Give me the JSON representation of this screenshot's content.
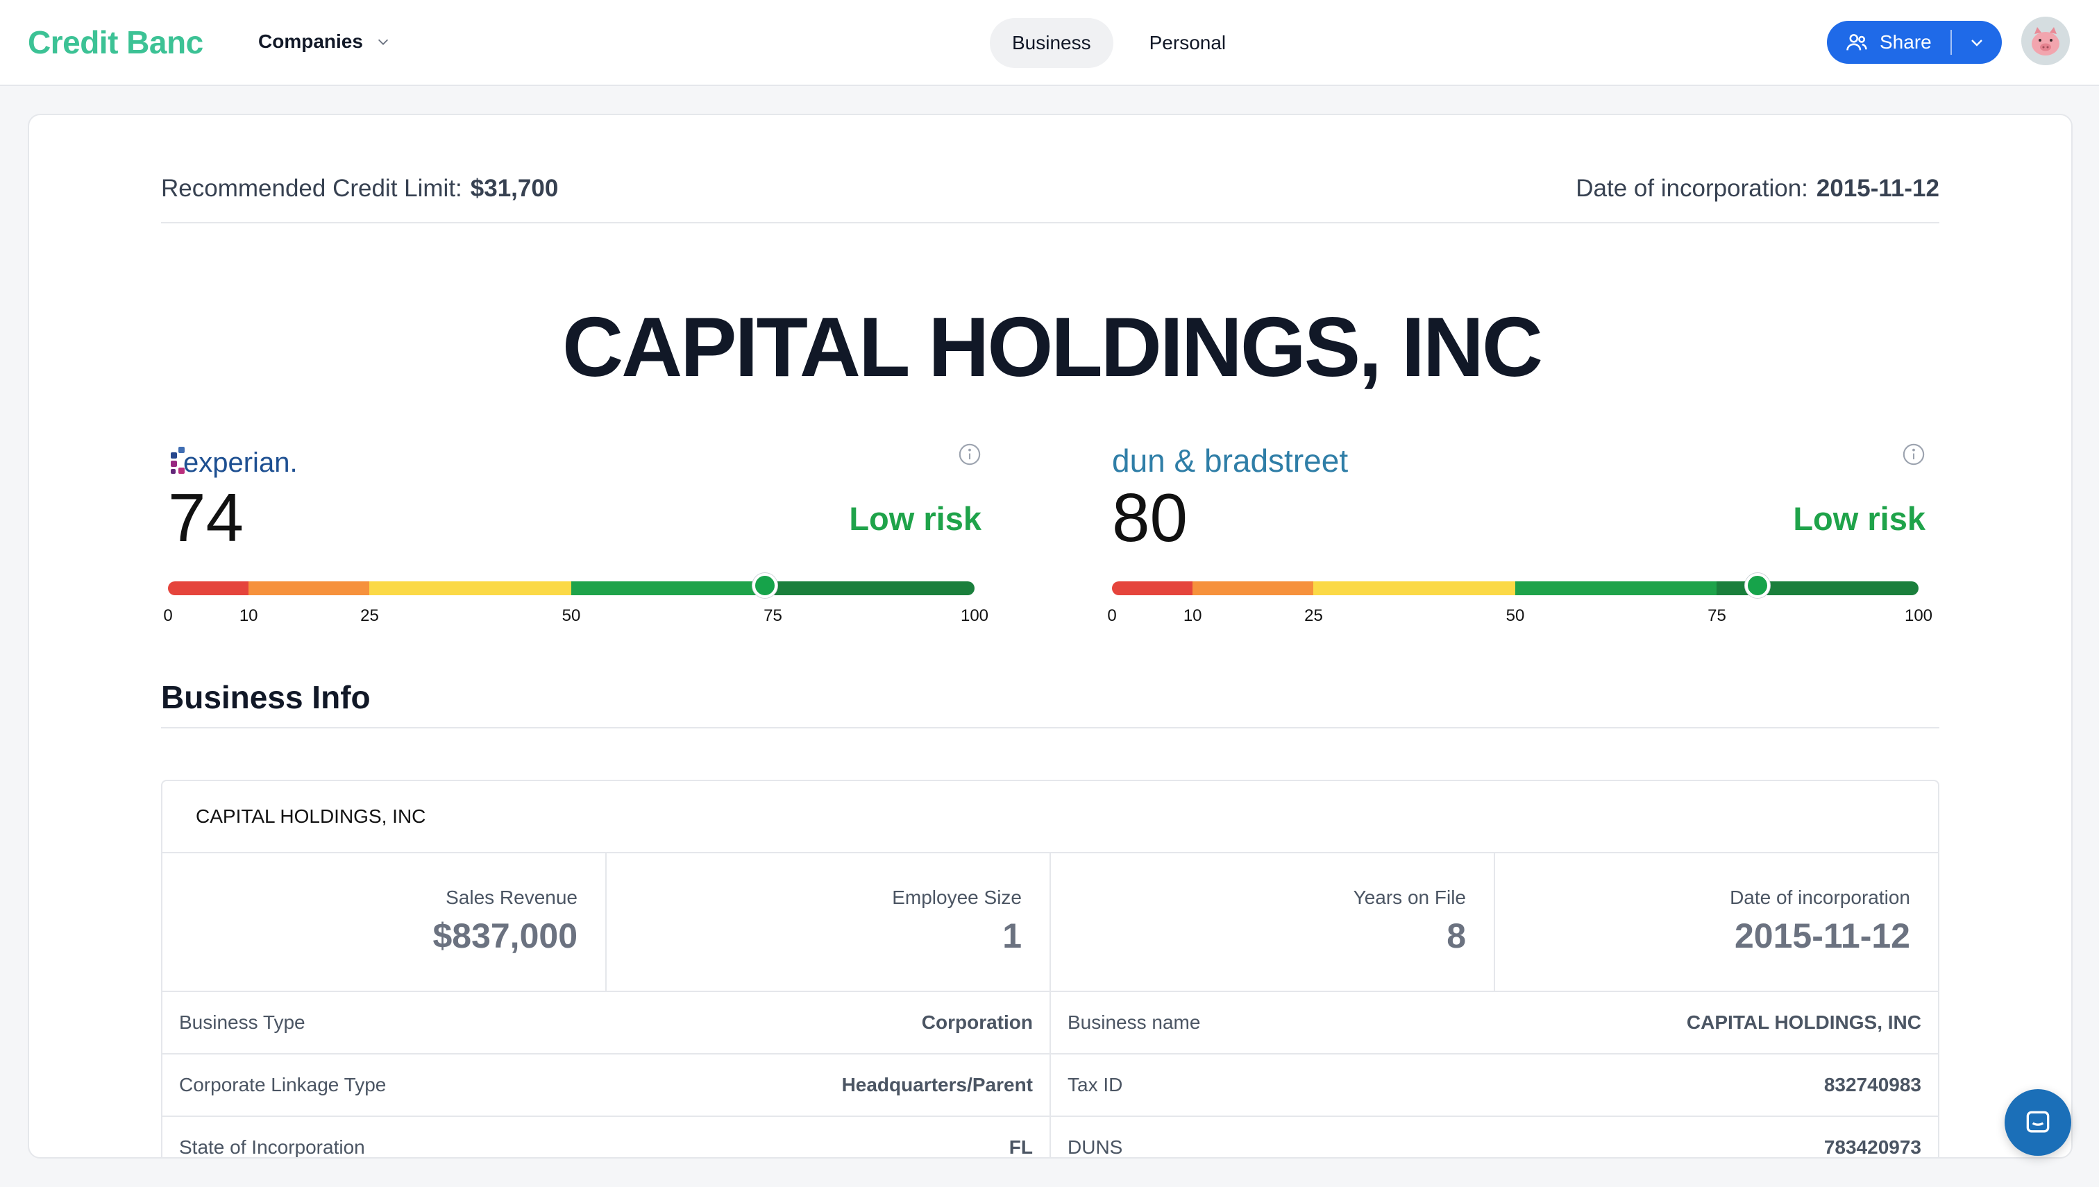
{
  "nav": {
    "logo": "Credit Banc",
    "companies_label": "Companies",
    "tabs": [
      {
        "label": "Business",
        "active": true
      },
      {
        "label": "Personal",
        "active": false
      }
    ],
    "share_label": "Share"
  },
  "summary": {
    "limit_label": "Recommended Credit Limit:",
    "limit_value": "$31,700",
    "inc_label": "Date of incorporation:",
    "inc_value": "2015-11-12"
  },
  "company_name": "CAPITAL HOLDINGS, INC",
  "scores": [
    {
      "bureau": "experian.",
      "score": "74",
      "risk": "Low risk",
      "ticks": [
        "0",
        "10",
        "25",
        "50",
        "75",
        "100"
      ]
    },
    {
      "bureau": "dun & bradstreet",
      "score": "80",
      "risk": "Low risk",
      "ticks": [
        "0",
        "10",
        "25",
        "50",
        "75",
        "100"
      ]
    }
  ],
  "gauge_colors": {
    "red": "#e5443c",
    "orange": "#f6913c",
    "yellow": "#fbd946",
    "green": "#1ea34a",
    "dark_green": "#1a7f3c",
    "risk_text": "#1fa34a"
  },
  "business_info": {
    "title": "Business Info",
    "name": "CAPITAL HOLDINGS, INC",
    "stats": [
      {
        "label": "Sales Revenue",
        "value": "$837,000"
      },
      {
        "label": "Employee Size",
        "value": "1"
      },
      {
        "label": "Years on File",
        "value": "8"
      },
      {
        "label": "Date of incorporation",
        "value": "2015-11-12"
      }
    ],
    "left_rows": [
      {
        "key": "Business Type",
        "value": "Corporation"
      },
      {
        "key": "Corporate Linkage Type",
        "value": "Headquarters/Parent"
      },
      {
        "key": "State of Incorporation",
        "value": "FL"
      }
    ],
    "right_rows": [
      {
        "key": "Business name",
        "value": "CAPITAL HOLDINGS, INC"
      },
      {
        "key": "Tax ID",
        "value": "832740983"
      },
      {
        "key": "DUNS",
        "value": "783420973"
      }
    ]
  }
}
